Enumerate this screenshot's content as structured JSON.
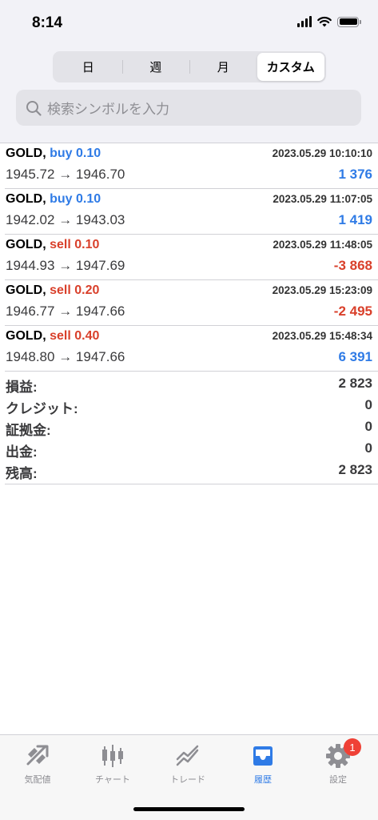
{
  "status_bar": {
    "time": "8:14"
  },
  "period_tabs": [
    {
      "label": "日",
      "active": false
    },
    {
      "label": "週",
      "active": false
    },
    {
      "label": "月",
      "active": false
    },
    {
      "label": "カスタム",
      "active": true
    }
  ],
  "search": {
    "placeholder": "検索シンボルを入力"
  },
  "trades": [
    {
      "symbol": "GOLD,",
      "side": "buy",
      "volume": "0.10",
      "datetime": "2023.05.29 10:10:10",
      "price_open": "1945.72",
      "price_close": "1946.70",
      "profit": "1 376",
      "profit_color": "blue"
    },
    {
      "symbol": "GOLD,",
      "side": "buy",
      "volume": "0.10",
      "datetime": "2023.05.29 11:07:05",
      "price_open": "1942.02",
      "price_close": "1943.03",
      "profit": "1 419",
      "profit_color": "blue"
    },
    {
      "symbol": "GOLD,",
      "side": "sell",
      "volume": "0.10",
      "datetime": "2023.05.29 11:48:05",
      "price_open": "1944.93",
      "price_close": "1947.69",
      "profit": "-3 868",
      "profit_color": "red"
    },
    {
      "symbol": "GOLD,",
      "side": "sell",
      "volume": "0.20",
      "datetime": "2023.05.29 15:23:09",
      "price_open": "1946.77",
      "price_close": "1947.66",
      "profit": "-2 495",
      "profit_color": "red"
    },
    {
      "symbol": "GOLD,",
      "side": "sell",
      "volume": "0.40",
      "datetime": "2023.05.29 15:48:34",
      "price_open": "1948.80",
      "price_close": "1947.66",
      "profit": "6 391",
      "profit_color": "blue"
    }
  ],
  "arrow": "→",
  "summary": [
    {
      "label": "損益:",
      "value": "2 823"
    },
    {
      "label": "クレジット:",
      "value": "0"
    },
    {
      "label": "証拠金:",
      "value": "0"
    },
    {
      "label": "出金:",
      "value": "0"
    },
    {
      "label": "残高:",
      "value": "2 823"
    }
  ],
  "tabbar": [
    {
      "label": "気配値",
      "icon": "quotes-icon",
      "active": false
    },
    {
      "label": "チャート",
      "icon": "candlestick-chart-icon",
      "active": false
    },
    {
      "label": "トレード",
      "icon": "trade-icon",
      "active": false
    },
    {
      "label": "履歴",
      "icon": "history-inbox-icon",
      "active": true
    },
    {
      "label": "設定",
      "icon": "gear-icon",
      "active": false,
      "badge": "1"
    }
  ],
  "colors": {
    "blue": "#2f7be6",
    "red": "#d9402b",
    "accent": "#2f7be6",
    "badge": "#ef4136"
  }
}
